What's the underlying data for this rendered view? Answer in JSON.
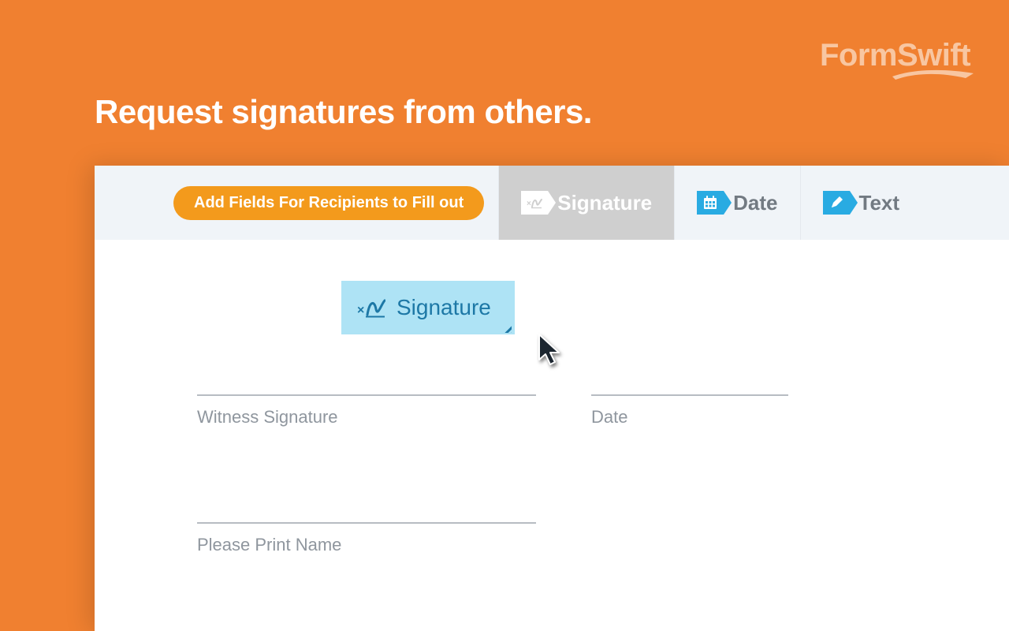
{
  "brand": {
    "name": "FormSwift"
  },
  "headline": "Request signatures from others.",
  "toolbar": {
    "pill_label": "Add Fields For Recipients to Fill out",
    "tools": [
      {
        "label": "Signature",
        "icon": "signature-icon",
        "active": true
      },
      {
        "label": "Date",
        "icon": "calendar-icon",
        "active": false
      },
      {
        "label": "Text",
        "icon": "pencil-icon",
        "active": false
      }
    ]
  },
  "dragged_field": {
    "label": "Signature"
  },
  "form_fields": {
    "witness_signature": "Witness Signature",
    "date": "Date",
    "print_name": "Please Print Name"
  }
}
